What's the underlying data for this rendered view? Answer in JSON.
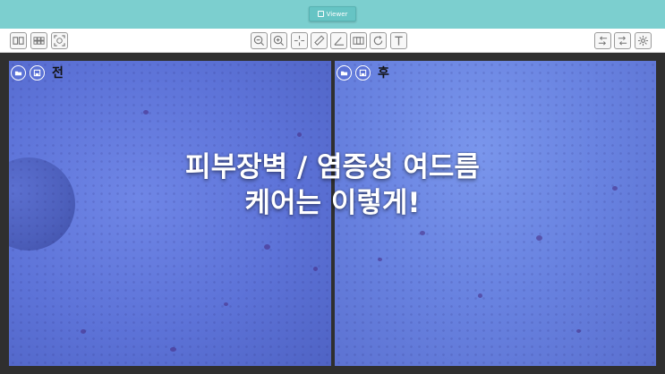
{
  "header": {
    "viewer_label": "Viewer"
  },
  "panels": {
    "left": {
      "label": "전"
    },
    "right": {
      "label": "후"
    }
  },
  "overlay": {
    "line1": "피부장벽 / 염증성 여드름",
    "line2": "케어는 이렇게!"
  },
  "colors": {
    "topbar": "#7ccfcf",
    "accent": "#66c4c4",
    "skin_blue": "#6378d9"
  },
  "icons": {
    "left_group": [
      "compare-view-icon",
      "grid-view-icon",
      "fullscreen-icon"
    ],
    "center_group": [
      "zoom-out-icon",
      "zoom-in-icon",
      "crosshair-icon",
      "ruler-icon",
      "angle-icon",
      "overlay-icon",
      "rotate-icon",
      "text-icon"
    ],
    "right_group": [
      "import-icon",
      "export-icon",
      "settings-icon"
    ]
  }
}
